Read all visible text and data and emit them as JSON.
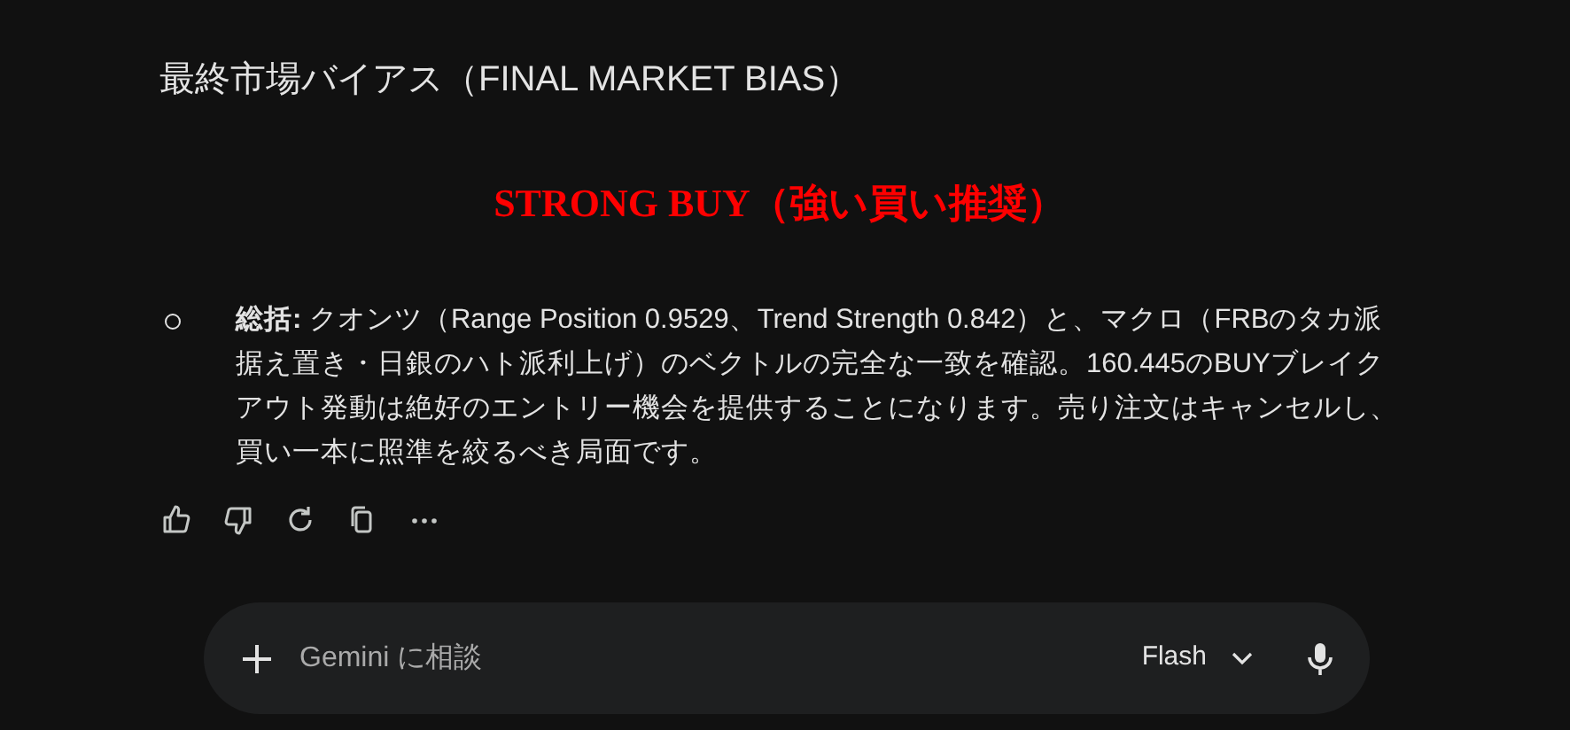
{
  "heading": "最終市場バイアス（FINAL MARKET BIAS）",
  "verdict": {
    "text": "STRONG BUY（強い買い推奨）",
    "color": "#ff0000"
  },
  "summary": "**総括:** クオンツ（Range Position 0.9529、Trend Strength 0.842）と、マクロ（FRBのタカ派据え置き・日銀のハト派利上げ）のベクトルの完全な一致を確認。160.445のBUYブレイクアウト発動は絶好のエントリー機会を提供することになります。売り注文はキャンセルし、買い一本に照準を絞るべき局面です。",
  "actions": [
    {
      "kind": "like"
    },
    {
      "kind": "dislike"
    },
    {
      "kind": "redo"
    },
    {
      "kind": "copy"
    },
    {
      "kind": "more"
    }
  ],
  "prompt": {
    "placeholder": "Gemini に相談",
    "model": "Flash"
  }
}
